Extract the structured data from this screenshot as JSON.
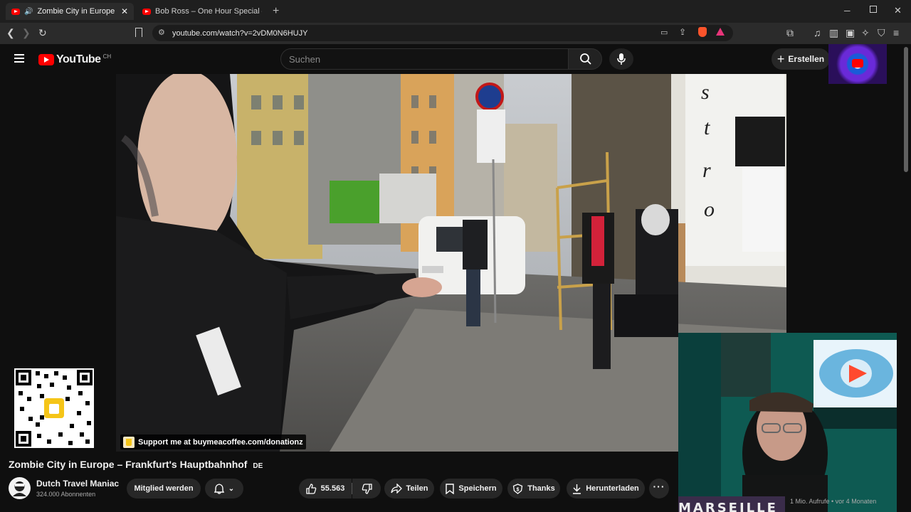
{
  "browser": {
    "tabs": [
      {
        "label": "Zombie City in Europe – Frankf",
        "active": true
      },
      {
        "label": "Bob Ross – One Hour Special – The G",
        "active": false
      }
    ],
    "new_tab_label": "+",
    "url": "youtube.com/watch?v=2vDM0N6HUJY"
  },
  "youtube": {
    "logo_text": "YouTube",
    "region": "CH",
    "search_placeholder": "Suchen",
    "create_label": "Erstellen"
  },
  "video": {
    "overlay_support_text": "Support me at buymeacoffee.com/donationz",
    "title": "Zombie City in Europe – Frankfurt's Hauptbahnhof",
    "title_flag": "DE"
  },
  "channel": {
    "name": "Dutch Travel Maniac",
    "subscribers": "324.000 Abonnenten",
    "join_label": "Mitglied werden"
  },
  "actions": {
    "likes": "55.563",
    "share": "Teilen",
    "save": "Speichern",
    "thanks": "Thanks",
    "download": "Herunterladen"
  },
  "webcam": {
    "bottom_text": "MARSEILLE"
  },
  "sidebar_meta": "1 Mio. Aufrufe • vor 4 Monaten",
  "colors": {
    "accent": "#ff0000",
    "chrome_bg": "#1f1f1f",
    "page_bg": "#0f0f0f"
  }
}
